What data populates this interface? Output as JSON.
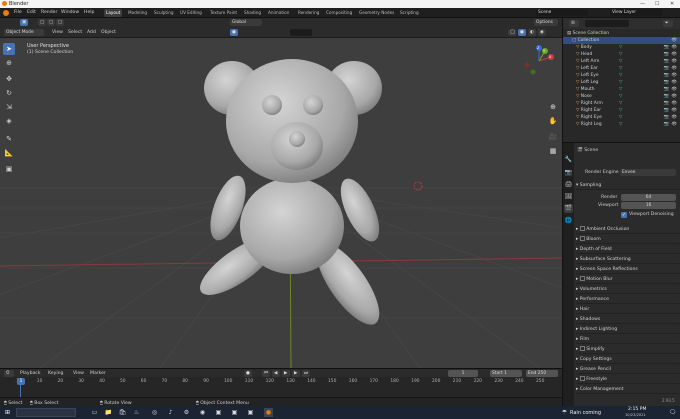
{
  "window": {
    "title": "Blender",
    "minimize": "—",
    "maximize": "☐",
    "close": "✕"
  },
  "menu": [
    "File",
    "Edit",
    "Render",
    "Window",
    "Help"
  ],
  "workspaces": [
    "Layout",
    "Modeling",
    "Sculpting",
    "UV Editing",
    "Texture Paint",
    "Shading",
    "Animation",
    "Rendering",
    "Compositing",
    "Geometry Nodes",
    "Scripting"
  ],
  "scene_field": {
    "value": "Scene"
  },
  "viewlayer_field": {
    "value": "View Layer"
  },
  "header": {
    "mode": "Object Mode",
    "menus": [
      "View",
      "Select",
      "Add",
      "Object"
    ],
    "transform_orientation": "Global",
    "options": "Options"
  },
  "viewport": {
    "label_line1": "User Perspective",
    "label_line2": "(1) Scene Collection",
    "gizmo": {
      "x": "X",
      "y": "Y",
      "z": "Z"
    }
  },
  "outliner": {
    "root": "Scene Collection",
    "collection": "Collection",
    "items": [
      "Body",
      "Head",
      "Left Arm",
      "Left Ear",
      "Left Eye",
      "Left Leg",
      "Mouth",
      "Nose",
      "Right Arm",
      "Right Ear",
      "Right Eye",
      "Right Leg"
    ]
  },
  "properties": {
    "breadcrumb": "Scene",
    "render_engine_label": "Render Engine",
    "render_engine_value": "Eevee",
    "sampling_label": "Sampling",
    "render_label": "Render",
    "render_value": "64",
    "viewport_label": "Viewport",
    "viewport_value": "16",
    "viewport_denoising": "Viewport Denoising",
    "sections": [
      "Ambient Occlusion",
      "Bloom",
      "Depth of Field",
      "Subsurface Scattering",
      "Screen Space Reflections",
      "Motion Blur",
      "Volumetrics",
      "Performance",
      "Hair",
      "Shadows",
      "Indirect Lighting",
      "Film",
      "Simplify",
      "Copy Settings",
      "Grease Pencil",
      "Freestyle",
      "Color Management"
    ]
  },
  "timeline": {
    "menus": [
      "Playback",
      "Keying",
      "View",
      "Marker"
    ],
    "current_frame": "1",
    "start_label": "Start",
    "start_value": "1",
    "end_label": "End",
    "end_value": "250",
    "ticks": [
      "1",
      "10",
      "20",
      "30",
      "40",
      "50",
      "60",
      "70",
      "80",
      "90",
      "100",
      "110",
      "120",
      "130",
      "140",
      "150",
      "160",
      "170",
      "180",
      "190",
      "200",
      "210",
      "220",
      "230",
      "240",
      "250"
    ]
  },
  "statusbar": {
    "select": "Select",
    "box_select": "Box Select",
    "rotate_view": "Rotate View",
    "context_menu": "Object Context Menu",
    "version": "2.93.5"
  },
  "taskbar": {
    "weather": "Rain coming",
    "time": "2:15 PM",
    "date": "10/23/2021"
  },
  "colors": {
    "accent": "#4772b3",
    "grid_x": "#8a3a3a",
    "grid_y": "#6b8a2a",
    "model": "#b9b9b9",
    "selected_row": "#334d80"
  }
}
